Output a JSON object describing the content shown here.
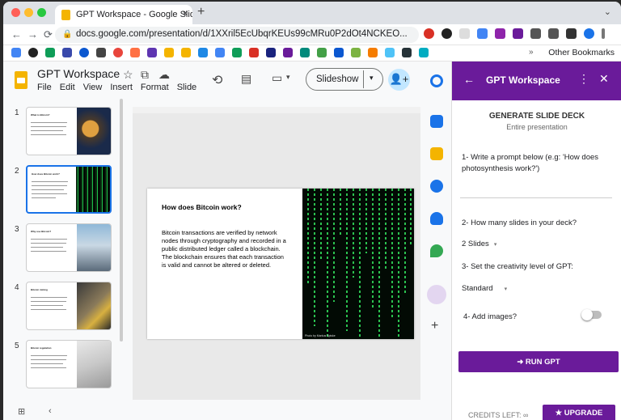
{
  "browser": {
    "tab_title": "GPT Workspace - Google Slide",
    "url": "docs.google.com/presentation/d/1XXril5EcUbqrKEUs99cMRu0P2dOt4NCKEO...",
    "bookmarks_other": "Other Bookmarks",
    "tab_close": "×",
    "new_tab": "+",
    "tab_menu": "⌄",
    "nav": {
      "back": "←",
      "forward": "→",
      "reload": "⟳"
    },
    "lock": "🔒",
    "ext_more": "»"
  },
  "app": {
    "doc_title": "GPT Workspace",
    "menu": [
      "File",
      "Edit",
      "View",
      "Insert",
      "Format",
      "Slide"
    ],
    "slideshow_label": "Slideshow",
    "icons": {
      "star": "☆",
      "folder": "⧉",
      "cloud": "☁",
      "history": "⟲",
      "comment": "▤",
      "meet": "▭",
      "share": "👤+",
      "dropdown": "▾",
      "grid": "⊞",
      "collapse": "‹",
      "add": "+"
    }
  },
  "slides": [
    {
      "num": "1",
      "title": "What is Bitcoin?"
    },
    {
      "num": "2",
      "title": "How does Bitcoin work?"
    },
    {
      "num": "3",
      "title": "Why use Bitcoin?"
    },
    {
      "num": "4",
      "title": "Bitcoin mining"
    },
    {
      "num": "5",
      "title": "Bitcoin regulation"
    }
  ],
  "current_slide": {
    "title": "How does Bitcoin work?",
    "body": "Bitcoin transactions are verified by network nodes through cryptography and recorded in a public distributed ledger called a blockchain. The blockchain ensures that each transaction is valid and cannot be altered or deleted.",
    "caption": "Photo by Markus Spiske"
  },
  "panel": {
    "title": "GPT Workspace",
    "back": "←",
    "more": "⋮",
    "close": "✕",
    "heading": "GENERATE SLIDE DECK",
    "subheading": "Entire presentation",
    "step1": "1- Write a prompt below (e.g: 'How does photosynthesis work?')",
    "step2": "2- How many slides in your deck?",
    "slides_value": "2 Slides",
    "step3": "3- Set the creativity level of GPT:",
    "creativity_value": "Standard",
    "step4": "4- Add images?",
    "add_images": false,
    "run_label": "➜ RUN GPT",
    "credits": "CREDITS LEFT: ∞",
    "upgrade_label": "★ UPGRADE"
  },
  "colors": {
    "accent": "#6a1b9a",
    "selected": "#1a73e8",
    "matrix": "#39ff6a"
  }
}
